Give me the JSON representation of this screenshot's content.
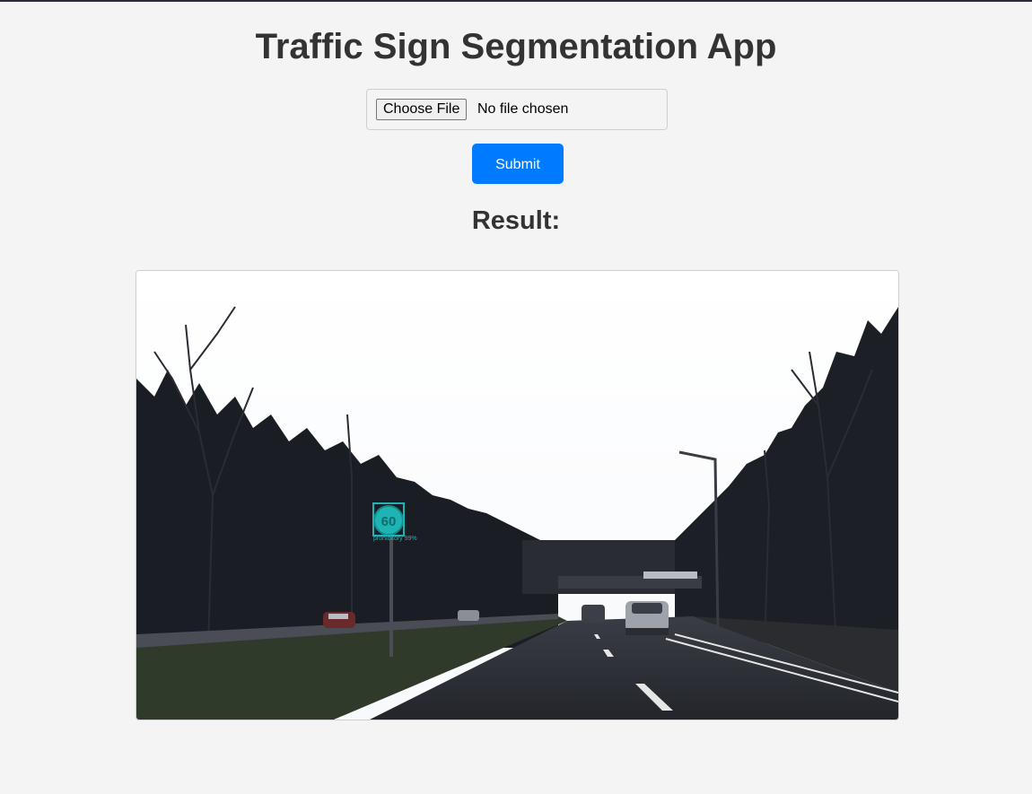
{
  "page": {
    "title": "Traffic Sign Segmentation App"
  },
  "upload": {
    "choose_label": "Choose File",
    "status": "No file chosen"
  },
  "submit_label": "Submit",
  "result": {
    "heading": "Result:",
    "sign_text": "60",
    "detection_label": "prohibitory 99%"
  },
  "colors": {
    "accent": "#007bff",
    "detection": "#1fb3b3"
  }
}
